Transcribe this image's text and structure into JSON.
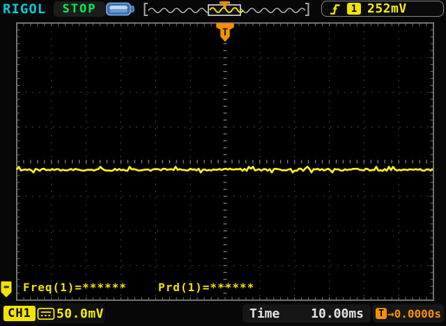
{
  "header": {
    "logo": "RIGOL",
    "run_status": "STOP",
    "battery_icon": "battery-icon",
    "hpos": {
      "marker": "T",
      "description": "horizontal position bar with trigger window highlight"
    },
    "trigger": {
      "slope_icon": "rising-edge-trigger-icon",
      "source_badge": "1",
      "level": "252mV"
    }
  },
  "display": {
    "trigger_marker": "T",
    "measurements": [
      {
        "text": "Freq(1)=******"
      },
      {
        "text": "Prd(1)=******"
      }
    ],
    "waveform": {
      "channel": "CH1",
      "shape": "flat noisy line slightly below center"
    }
  },
  "footer": {
    "channel": {
      "badge": "CH1",
      "coupling_icon": "dc-coupling-icon",
      "scale": "50.0mV"
    },
    "timebase": {
      "label": "Time",
      "value": "10.00ms"
    },
    "trigger_offset": {
      "badge": "T",
      "value": "→0.0000s"
    }
  },
  "colors": {
    "channel1_yellow": "#f8f000",
    "trigger_orange": "#f79000",
    "run_green": "#00ee4e",
    "logo_cyan": "#00ccd8",
    "grid_gray": "#555555"
  }
}
